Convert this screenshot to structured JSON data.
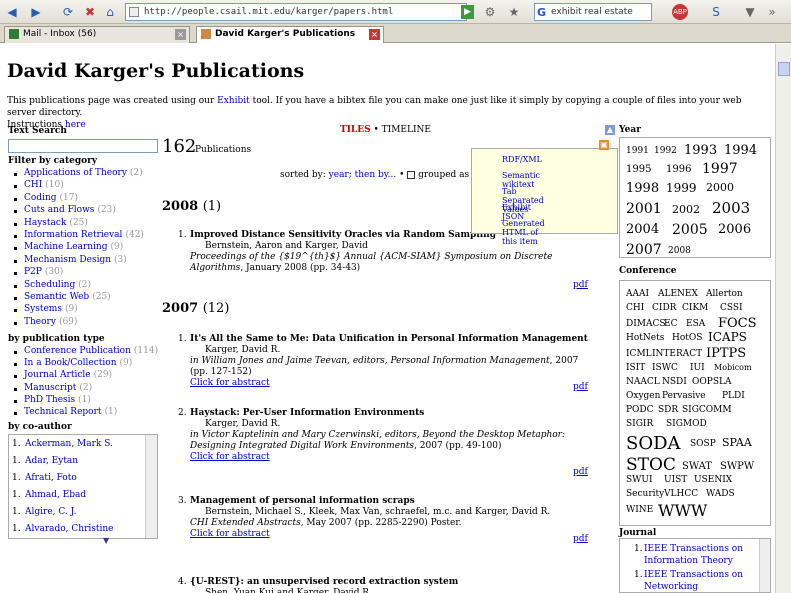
{
  "browser": {
    "url": "http://people.csail.mit.edu/karger/papers.html",
    "search_value": "exhibit real estate",
    "tabs": [
      {
        "label": "Mail - Inbox (56)"
      },
      {
        "label": "David Karger's Publications"
      }
    ]
  },
  "page": {
    "title": "David Karger's Publications",
    "intro_text": "This publications page was created using our ",
    "intro_link": "Exhibit",
    "intro_text2": " tool. If you have a bibtex file you can make one just like it simply by copying a couple of files into your web server directory.",
    "intro_instr": "Instructions ",
    "intro_here": "here",
    "text_search_label": "Text Search",
    "pub_count": "162",
    "pub_count_label": "Publications",
    "views": {
      "tiles": "TILES",
      "sep": " • ",
      "timeline": "TIMELINE"
    },
    "sort_text": "sorted by: ",
    "sort_link": "year; then by...",
    "sort_grouped": "grouped as so",
    "filter_category_label": "Filter by category",
    "categories": [
      {
        "name": "Applications of Theory",
        "count": "(2)"
      },
      {
        "name": "CHI",
        "count": "(10)"
      },
      {
        "name": "Coding",
        "count": "(17)"
      },
      {
        "name": "Cuts and Flows",
        "count": "(23)"
      },
      {
        "name": "Haystack",
        "count": "(25)"
      },
      {
        "name": "Information Retrieval",
        "count": "(42)"
      },
      {
        "name": "Machine Learning",
        "count": "(9)"
      },
      {
        "name": "Mechanism Design",
        "count": "(3)"
      },
      {
        "name": "P2P",
        "count": "(30)"
      },
      {
        "name": "Scheduling",
        "count": "(2)"
      },
      {
        "name": "Semantic Web",
        "count": "(25)"
      },
      {
        "name": "Systems",
        "count": "(9)"
      },
      {
        "name": "Theory",
        "count": "(69)"
      }
    ],
    "by_pub_type_label": "by publication type",
    "pub_types": [
      {
        "name": "Conference Publication",
        "count": "(114)"
      },
      {
        "name": "In a Book/Collection",
        "count": "(9)"
      },
      {
        "name": "Journal Article",
        "count": "(29)"
      },
      {
        "name": "Manuscript",
        "count": "(2)"
      },
      {
        "name": "PhD Thesis",
        "count": "(1)"
      },
      {
        "name": "Technical Report",
        "count": "(1)"
      }
    ],
    "by_coauthor_label": "by co-author",
    "coauthors": [
      {
        "n": "1.",
        "name": "Ackerman, Mark S."
      },
      {
        "n": "1.",
        "name": "Adar, Eytan"
      },
      {
        "n": "1.",
        "name": "Afrati, Foto"
      },
      {
        "n": "1.",
        "name": "Ahmad, Ebad"
      },
      {
        "n": "1.",
        "name": "Algire, C. J."
      },
      {
        "n": "1.",
        "name": "Alvarado, Christine"
      }
    ],
    "export_menu": [
      "RDF/XML",
      "Semantic wikitext",
      "Tab Separated Values",
      "Exhibit JSON",
      "Generated HTML of this item"
    ],
    "years": [
      {
        "label": "2008",
        "count": "(1)"
      },
      {
        "label": "2007",
        "count": "(12)"
      }
    ],
    "pubs": [
      {
        "n": "1.",
        "title": "Improved Distance Sensitivity Oracles via Random Sampling",
        "authors": "Bernstein, Aaron and Karger, David",
        "venue": "Proceedings of the {$19^{th}$} Annual {ACM-SIAM} Symposium on Discrete Algorithms",
        "date": ", January 2008 (pp. 34-43)",
        "pdf": "pdf"
      },
      {
        "n": "1.",
        "title": "It's All the Same to Me: Data Unification in Personal Information Management",
        "authors": "Karger, David R.",
        "venue": "in William Jones and Jaime Teevan, editors, Personal Information Management",
        "date": ", 2007 (pp. 127-152)",
        "abstract": "Click for abstract",
        "pdf": "pdf"
      },
      {
        "n": "2.",
        "title": "Haystack: Per-User Information Environments",
        "authors": "Karger, David R.",
        "venue": "in Victor Kaptelinin and Mary Czerwinski, editors, Beyond the Desktop Metaphor: Designing Integrated Digital Work Environments",
        "date": ", 2007 (pp. 49-100)",
        "abstract": "Click for abstract",
        "pdf": "pdf"
      },
      {
        "n": "3.",
        "title": "Management of personal information scraps",
        "authors": "Bernstein, Michael S., Kleek, Max Van, schraefel, m.c. and Karger, David R.",
        "venue": "CHI Extended Abstracts",
        "date": ", May 2007 (pp. 2285-2290) Poster.",
        "abstract": "Click for abstract",
        "pdf": "pdf"
      },
      {
        "n": "4.",
        "title": "{U-REST}: an unsupervised record extraction system",
        "authors": "Shen, Yuan Kui and Karger, David R.",
        "venue": "",
        "date": "",
        "pdf": ""
      }
    ],
    "year_label": "Year",
    "year_cloud": [
      "1991",
      "1992",
      "1993",
      "1994",
      "1995",
      "1996",
      "1997",
      "1998",
      "1999",
      "2000",
      "2001",
      "2002",
      "2003",
      "2004",
      "2005",
      "2006",
      "2007",
      "2008"
    ],
    "conference_label": "Conference",
    "conference_cloud": [
      "AAAI",
      "ALENEX",
      "Allerton",
      "CHI",
      "CIDR",
      "CIKM",
      "CSSI",
      "DIMACS",
      "EC",
      "ESA",
      "FOCS",
      "HotNets",
      "HotOS",
      "ICAPS",
      "ICML",
      "INTERACT",
      "IPTPS",
      "ISIT",
      "ISWC",
      "IUI",
      "Mobicom",
      "NAACL",
      "NSDI",
      "OOPSLA",
      "Oxygen",
      "Pervasive",
      "PLDI",
      "PODC",
      "SDR",
      "SIGCOMM",
      "SIGIR",
      "SIGMOD",
      "SODA",
      "SOSP",
      "SPAA",
      "STOC",
      "SWAT",
      "SWPW",
      "SWUI",
      "UIST",
      "USENIX",
      "Security",
      "VLHCC",
      "WADS",
      "WINE",
      "WWW"
    ],
    "journal_label": "Journal",
    "journals": [
      {
        "n": "1.",
        "name": "IEEE Transactions on Information Theory"
      },
      {
        "n": "1.",
        "name": "IEEE Transactions on Networking"
      }
    ]
  }
}
